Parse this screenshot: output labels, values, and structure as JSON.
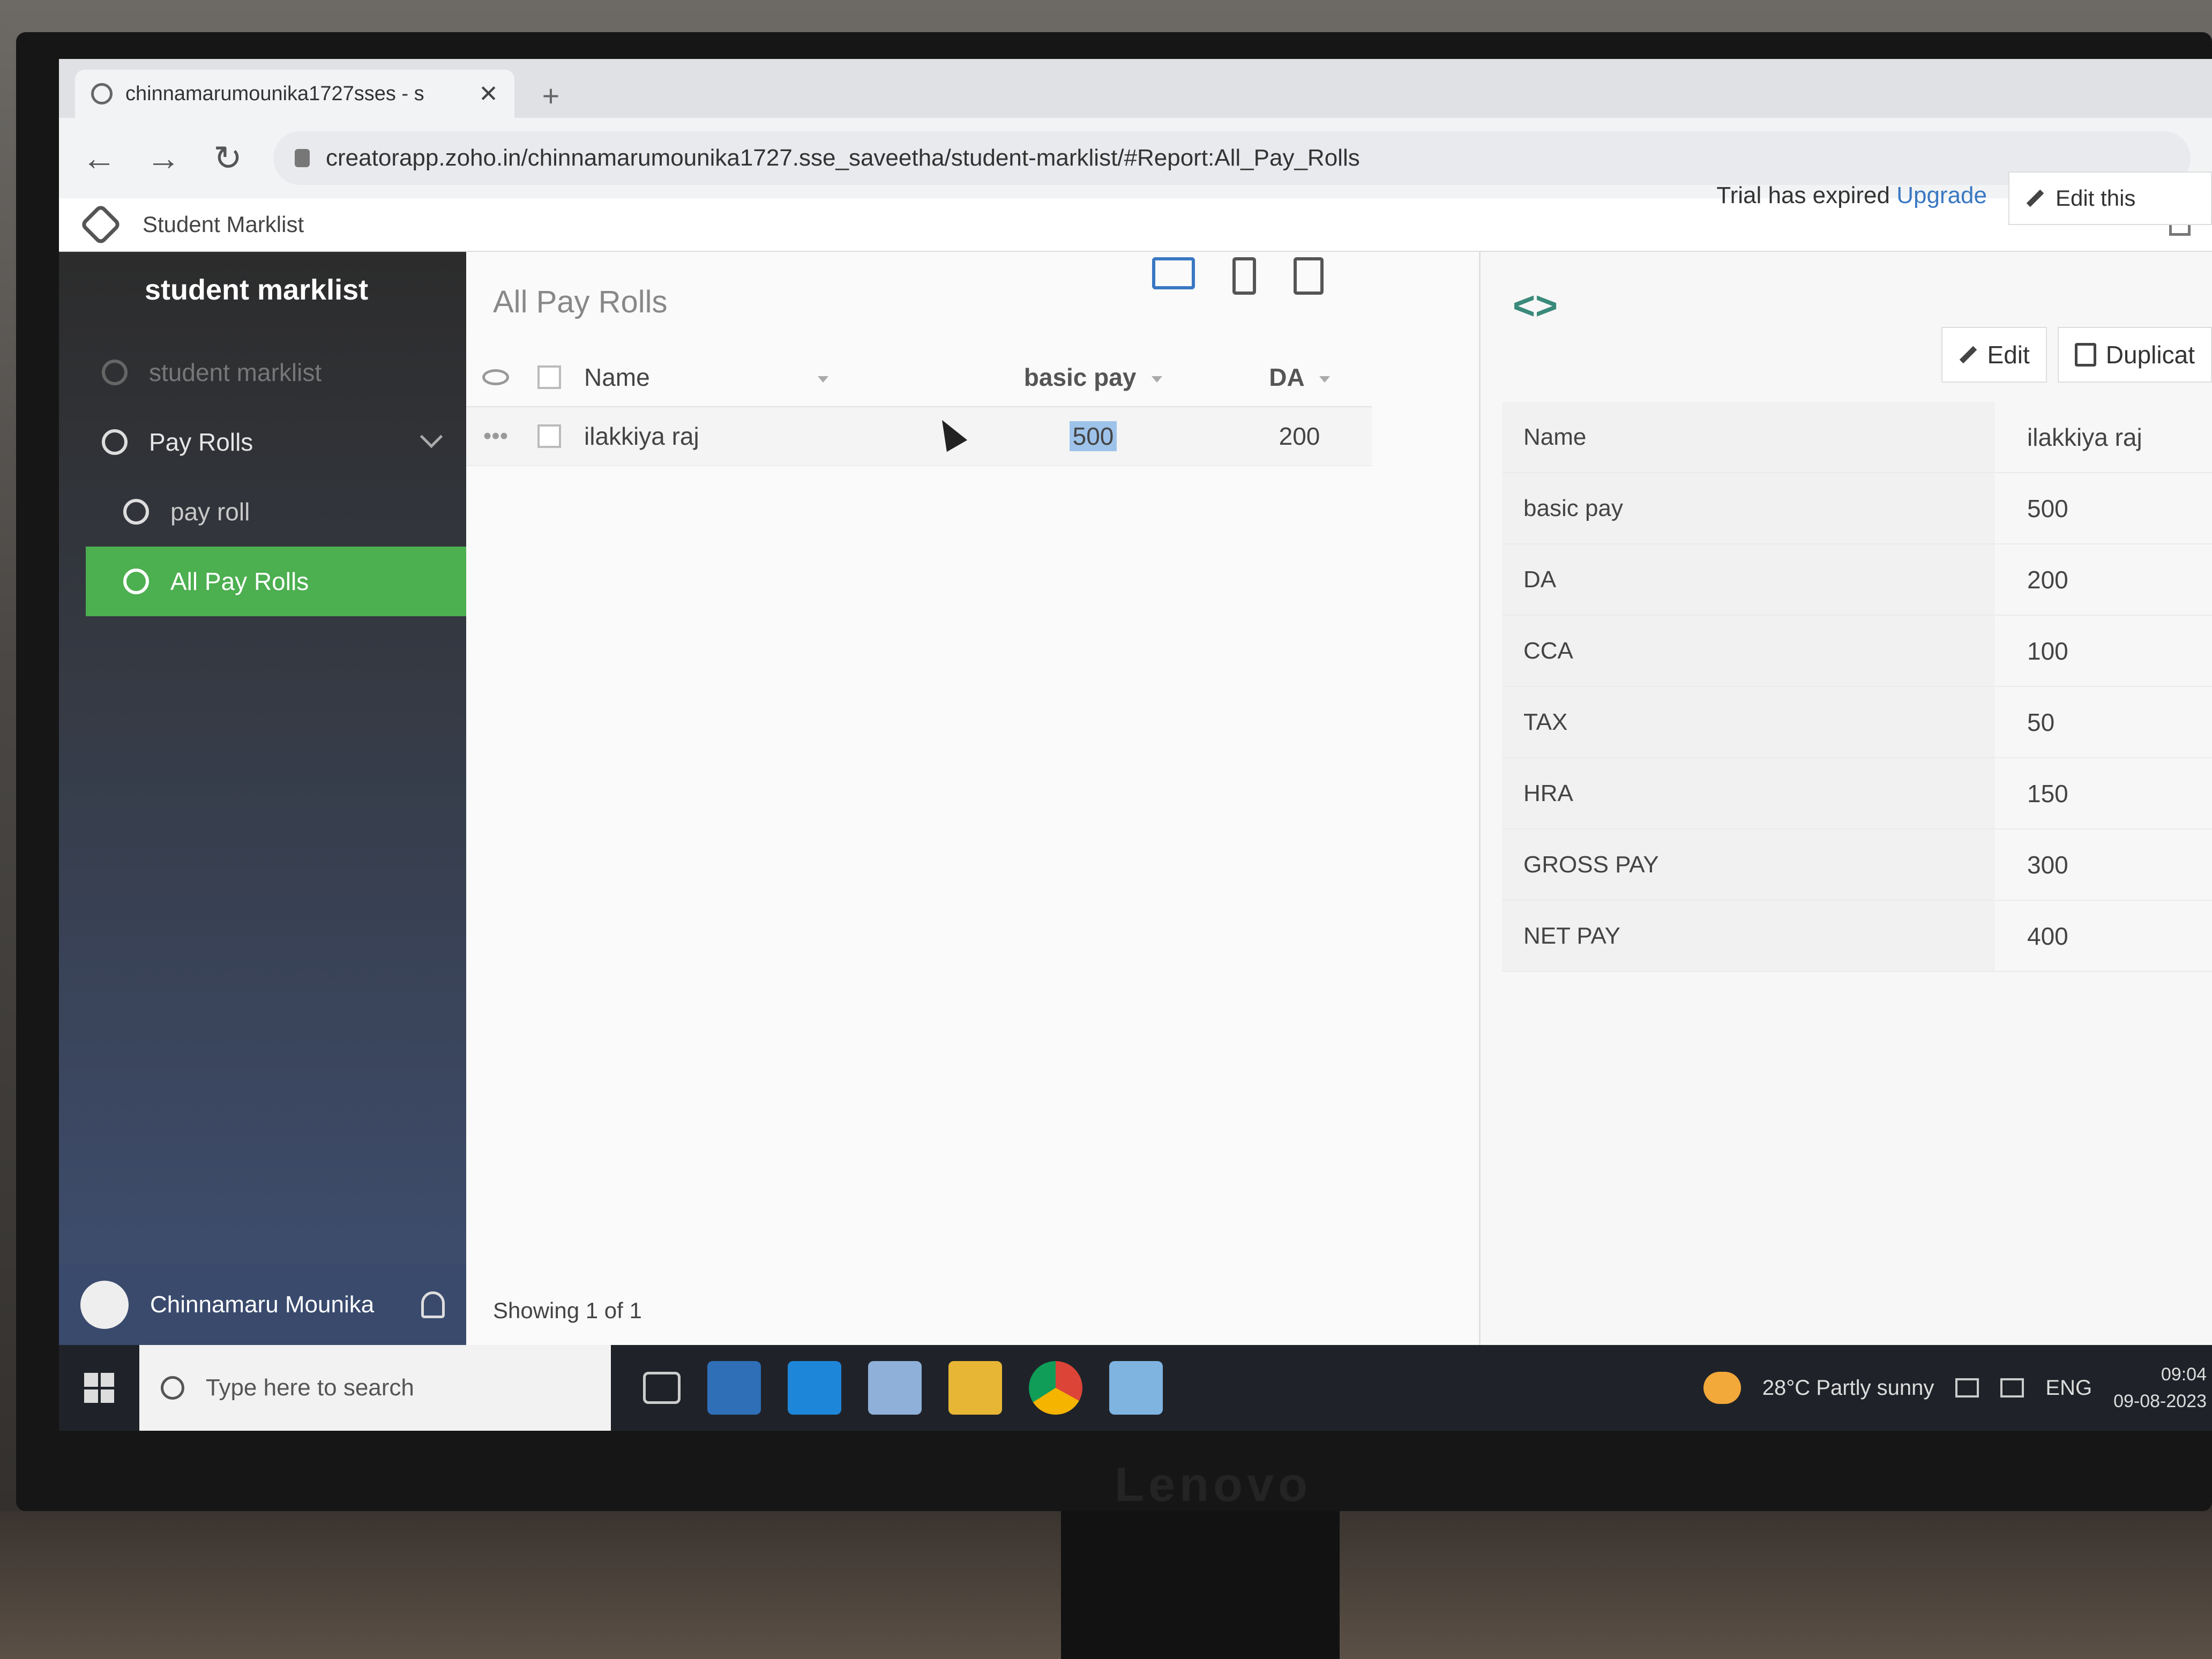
{
  "browser": {
    "tab_title": "chinnamarumounika1727sses - s",
    "new_tab": "+",
    "url": "creatorapp.zoho.in/chinnamarumounika1727.sse_saveetha/student-marklist/#Report:All_Pay_Rolls",
    "bookmark_title": "Student Marklist"
  },
  "sidebar": {
    "header": "student marklist",
    "items": [
      {
        "label": "student marklist"
      },
      {
        "label": "Pay Rolls"
      },
      {
        "label": "pay roll"
      },
      {
        "label": "All Pay Rolls"
      }
    ],
    "user_name": "Chinnamaru Mounika"
  },
  "report": {
    "title": "All Pay Rolls",
    "columns": {
      "name": "Name",
      "basic_pay": "basic pay",
      "da": "DA"
    },
    "rows": [
      {
        "name": "ilakkiya raj",
        "basic_pay": "500",
        "da": "200"
      }
    ],
    "footer": "Showing 1 of 1"
  },
  "header_right": {
    "trial_text": "Trial has expired",
    "upgrade": "Upgrade",
    "edit_this": "Edit this"
  },
  "detail": {
    "edit_label": "Edit",
    "duplicate_label": "Duplicat",
    "fields": [
      {
        "label": "Name",
        "value": "ilakkiya raj"
      },
      {
        "label": "basic pay",
        "value": "500"
      },
      {
        "label": "DA",
        "value": "200"
      },
      {
        "label": "CCA",
        "value": "100"
      },
      {
        "label": "TAX",
        "value": "50"
      },
      {
        "label": "HRA",
        "value": "150"
      },
      {
        "label": "GROSS PAY",
        "value": "300"
      },
      {
        "label": "NET PAY",
        "value": "400"
      }
    ]
  },
  "taskbar": {
    "search_placeholder": "Type here to search",
    "weather": "28°C  Partly sunny",
    "language": "ENG",
    "time": "09:04",
    "date": "09-08-2023"
  },
  "monitor_brand": "Lenovo"
}
